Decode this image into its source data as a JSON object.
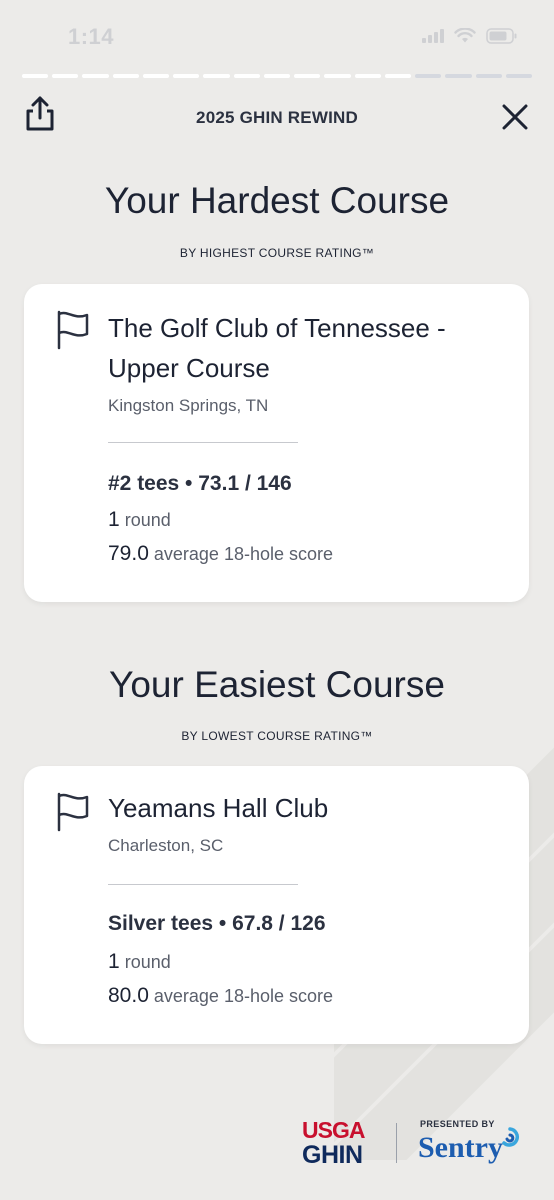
{
  "status_bar": {
    "time": "1:14",
    "icons": [
      "signal-icon",
      "wifi-icon",
      "battery-icon"
    ]
  },
  "progress": {
    "total_segments": 17,
    "completed_segments": 13
  },
  "header": {
    "title": "2025 GHIN REWIND",
    "share_icon": "share-icon",
    "close_icon": "close-icon"
  },
  "hardest": {
    "title": "Your Hardest Course",
    "subtitle": "BY HIGHEST COURSE RATING™",
    "course_name_line1": "The Golf Club of Tennessee -",
    "course_name_line2": "Upper Course",
    "location": "Kingston Springs, TN",
    "tees": "#2 tees • 73.1 / 146",
    "rounds_value": "1",
    "rounds_label": "round",
    "avg_value": "79.0",
    "avg_label": "average 18-hole score",
    "icon": "flag-icon"
  },
  "easiest": {
    "title": "Your Easiest Course",
    "subtitle": "BY LOWEST COURSE RATING™",
    "course_name_line1": "Yeamans Hall Club",
    "location": "Charleston, SC",
    "tees": "Silver tees • 67.8 / 126",
    "rounds_value": "1",
    "rounds_label": "round",
    "avg_value": "80.0",
    "avg_label": "average 18-hole score",
    "icon": "flag-icon"
  },
  "footer": {
    "usga": "USGA",
    "ghin": "GHIN",
    "presented_by": "PRESENTED BY",
    "sponsor": "Sentry"
  },
  "colors": {
    "background": "#ecebe9",
    "text": "#1d2333",
    "usga_red": "#c8102e",
    "ghin_navy": "#0f2a5c",
    "sentry_blue": "#1d5db0"
  }
}
